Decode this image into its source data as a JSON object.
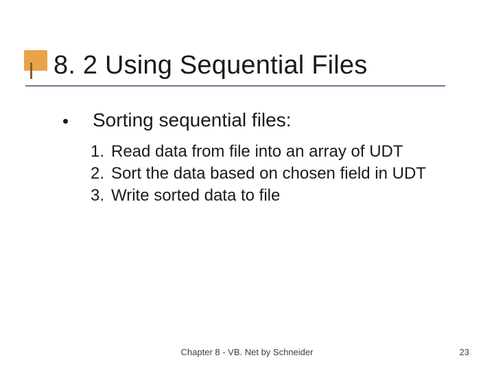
{
  "title": "8. 2 Using Sequential Files",
  "bullet": "Sorting sequential files:",
  "steps": [
    {
      "num": "1.",
      "text": "Read data from file into an array of UDT"
    },
    {
      "num": "2.",
      "text": "Sort the data based on chosen field in UDT"
    },
    {
      "num": "3.",
      "text": "Write sorted data to file"
    }
  ],
  "footer": {
    "center": "Chapter 8 - VB. Net by Schneider",
    "page": "23"
  }
}
